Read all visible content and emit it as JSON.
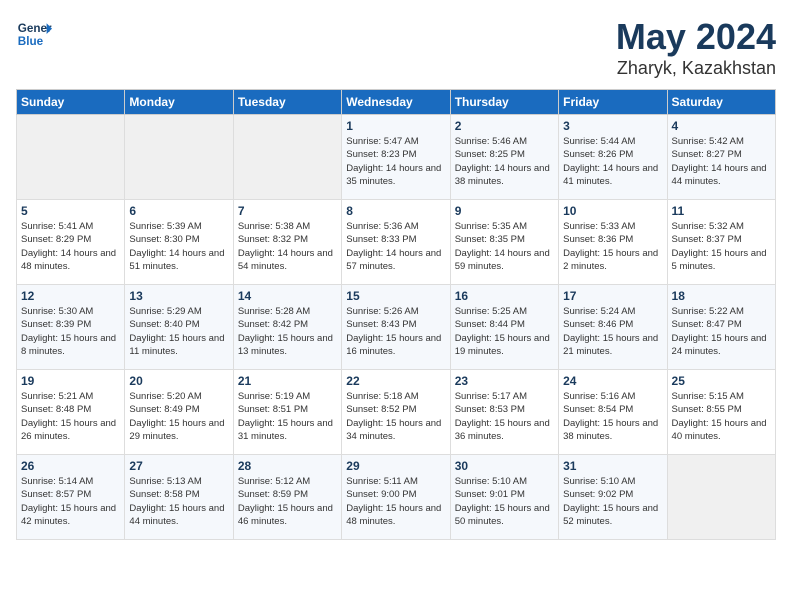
{
  "logo": {
    "line1": "General",
    "line2": "Blue"
  },
  "title": "May 2024",
  "subtitle": "Zharyk, Kazakhstan",
  "headers": [
    "Sunday",
    "Monday",
    "Tuesday",
    "Wednesday",
    "Thursday",
    "Friday",
    "Saturday"
  ],
  "weeks": [
    [
      {
        "num": "",
        "sunrise": "",
        "sunset": "",
        "daylight": "",
        "empty": true
      },
      {
        "num": "",
        "sunrise": "",
        "sunset": "",
        "daylight": "",
        "empty": true
      },
      {
        "num": "",
        "sunrise": "",
        "sunset": "",
        "daylight": "",
        "empty": true
      },
      {
        "num": "1",
        "sunrise": "Sunrise: 5:47 AM",
        "sunset": "Sunset: 8:23 PM",
        "daylight": "Daylight: 14 hours and 35 minutes."
      },
      {
        "num": "2",
        "sunrise": "Sunrise: 5:46 AM",
        "sunset": "Sunset: 8:25 PM",
        "daylight": "Daylight: 14 hours and 38 minutes."
      },
      {
        "num": "3",
        "sunrise": "Sunrise: 5:44 AM",
        "sunset": "Sunset: 8:26 PM",
        "daylight": "Daylight: 14 hours and 41 minutes."
      },
      {
        "num": "4",
        "sunrise": "Sunrise: 5:42 AM",
        "sunset": "Sunset: 8:27 PM",
        "daylight": "Daylight: 14 hours and 44 minutes."
      }
    ],
    [
      {
        "num": "5",
        "sunrise": "Sunrise: 5:41 AM",
        "sunset": "Sunset: 8:29 PM",
        "daylight": "Daylight: 14 hours and 48 minutes."
      },
      {
        "num": "6",
        "sunrise": "Sunrise: 5:39 AM",
        "sunset": "Sunset: 8:30 PM",
        "daylight": "Daylight: 14 hours and 51 minutes."
      },
      {
        "num": "7",
        "sunrise": "Sunrise: 5:38 AM",
        "sunset": "Sunset: 8:32 PM",
        "daylight": "Daylight: 14 hours and 54 minutes."
      },
      {
        "num": "8",
        "sunrise": "Sunrise: 5:36 AM",
        "sunset": "Sunset: 8:33 PM",
        "daylight": "Daylight: 14 hours and 57 minutes."
      },
      {
        "num": "9",
        "sunrise": "Sunrise: 5:35 AM",
        "sunset": "Sunset: 8:35 PM",
        "daylight": "Daylight: 14 hours and 59 minutes."
      },
      {
        "num": "10",
        "sunrise": "Sunrise: 5:33 AM",
        "sunset": "Sunset: 8:36 PM",
        "daylight": "Daylight: 15 hours and 2 minutes."
      },
      {
        "num": "11",
        "sunrise": "Sunrise: 5:32 AM",
        "sunset": "Sunset: 8:37 PM",
        "daylight": "Daylight: 15 hours and 5 minutes."
      }
    ],
    [
      {
        "num": "12",
        "sunrise": "Sunrise: 5:30 AM",
        "sunset": "Sunset: 8:39 PM",
        "daylight": "Daylight: 15 hours and 8 minutes."
      },
      {
        "num": "13",
        "sunrise": "Sunrise: 5:29 AM",
        "sunset": "Sunset: 8:40 PM",
        "daylight": "Daylight: 15 hours and 11 minutes."
      },
      {
        "num": "14",
        "sunrise": "Sunrise: 5:28 AM",
        "sunset": "Sunset: 8:42 PM",
        "daylight": "Daylight: 15 hours and 13 minutes."
      },
      {
        "num": "15",
        "sunrise": "Sunrise: 5:26 AM",
        "sunset": "Sunset: 8:43 PM",
        "daylight": "Daylight: 15 hours and 16 minutes."
      },
      {
        "num": "16",
        "sunrise": "Sunrise: 5:25 AM",
        "sunset": "Sunset: 8:44 PM",
        "daylight": "Daylight: 15 hours and 19 minutes."
      },
      {
        "num": "17",
        "sunrise": "Sunrise: 5:24 AM",
        "sunset": "Sunset: 8:46 PM",
        "daylight": "Daylight: 15 hours and 21 minutes."
      },
      {
        "num": "18",
        "sunrise": "Sunrise: 5:22 AM",
        "sunset": "Sunset: 8:47 PM",
        "daylight": "Daylight: 15 hours and 24 minutes."
      }
    ],
    [
      {
        "num": "19",
        "sunrise": "Sunrise: 5:21 AM",
        "sunset": "Sunset: 8:48 PM",
        "daylight": "Daylight: 15 hours and 26 minutes."
      },
      {
        "num": "20",
        "sunrise": "Sunrise: 5:20 AM",
        "sunset": "Sunset: 8:49 PM",
        "daylight": "Daylight: 15 hours and 29 minutes."
      },
      {
        "num": "21",
        "sunrise": "Sunrise: 5:19 AM",
        "sunset": "Sunset: 8:51 PM",
        "daylight": "Daylight: 15 hours and 31 minutes."
      },
      {
        "num": "22",
        "sunrise": "Sunrise: 5:18 AM",
        "sunset": "Sunset: 8:52 PM",
        "daylight": "Daylight: 15 hours and 34 minutes."
      },
      {
        "num": "23",
        "sunrise": "Sunrise: 5:17 AM",
        "sunset": "Sunset: 8:53 PM",
        "daylight": "Daylight: 15 hours and 36 minutes."
      },
      {
        "num": "24",
        "sunrise": "Sunrise: 5:16 AM",
        "sunset": "Sunset: 8:54 PM",
        "daylight": "Daylight: 15 hours and 38 minutes."
      },
      {
        "num": "25",
        "sunrise": "Sunrise: 5:15 AM",
        "sunset": "Sunset: 8:55 PM",
        "daylight": "Daylight: 15 hours and 40 minutes."
      }
    ],
    [
      {
        "num": "26",
        "sunrise": "Sunrise: 5:14 AM",
        "sunset": "Sunset: 8:57 PM",
        "daylight": "Daylight: 15 hours and 42 minutes."
      },
      {
        "num": "27",
        "sunrise": "Sunrise: 5:13 AM",
        "sunset": "Sunset: 8:58 PM",
        "daylight": "Daylight: 15 hours and 44 minutes."
      },
      {
        "num": "28",
        "sunrise": "Sunrise: 5:12 AM",
        "sunset": "Sunset: 8:59 PM",
        "daylight": "Daylight: 15 hours and 46 minutes."
      },
      {
        "num": "29",
        "sunrise": "Sunrise: 5:11 AM",
        "sunset": "Sunset: 9:00 PM",
        "daylight": "Daylight: 15 hours and 48 minutes."
      },
      {
        "num": "30",
        "sunrise": "Sunrise: 5:10 AM",
        "sunset": "Sunset: 9:01 PM",
        "daylight": "Daylight: 15 hours and 50 minutes."
      },
      {
        "num": "31",
        "sunrise": "Sunrise: 5:10 AM",
        "sunset": "Sunset: 9:02 PM",
        "daylight": "Daylight: 15 hours and 52 minutes."
      },
      {
        "num": "",
        "sunrise": "",
        "sunset": "",
        "daylight": "",
        "empty": true
      }
    ]
  ]
}
